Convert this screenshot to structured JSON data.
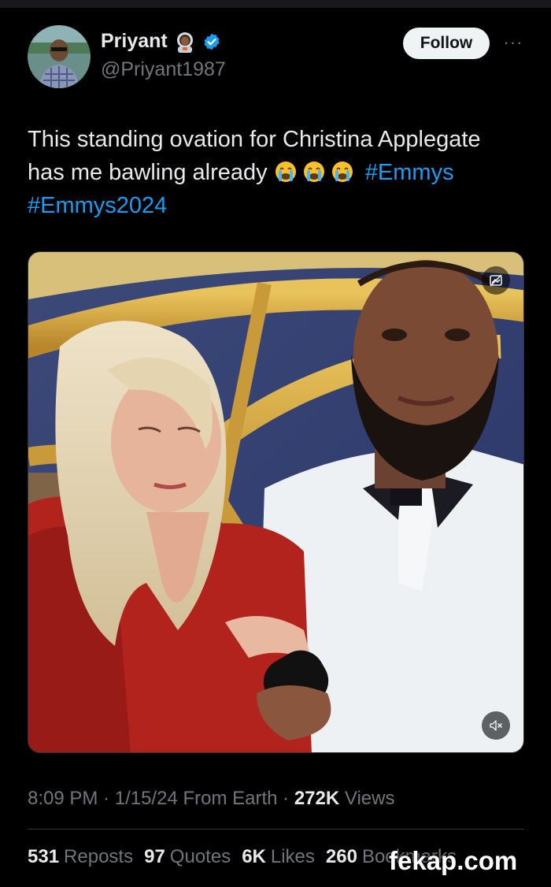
{
  "author": {
    "display_name": "Priyant",
    "name_emoji": "astronaut-emoji",
    "verified": true,
    "handle": "@Priyant1987"
  },
  "actions": {
    "follow_label": "Follow",
    "more_label": "···"
  },
  "tweet": {
    "text_part1": "This standing ovation for Christina Applegate has me bawling already ",
    "emojis": [
      "loudly-crying-face",
      "loudly-crying-face",
      "loudly-crying-face"
    ],
    "hashtag1": "#Emmys",
    "hashtag2": "#Emmys2024"
  },
  "media": {
    "type": "video",
    "top_icon": "sensitive-media-icon",
    "mute_icon": "muted-speaker-icon"
  },
  "meta": {
    "time": "8:09 PM",
    "sep1": " · ",
    "date": "1/15/24",
    "source": " From Earth",
    "sep2": " · ",
    "views_count": "272K",
    "views_label": " Views"
  },
  "stats": {
    "reposts_count": "531",
    "reposts_label": "Reposts",
    "quotes_count": "97",
    "quotes_label": "Quotes",
    "likes_count": "6K",
    "likes_label": "Likes",
    "bookmarks_count": "260",
    "bookmarks_label": "Bookmarks"
  },
  "watermark": "fekap.com",
  "colors": {
    "background": "#000000",
    "accent": "#1d9bf0",
    "secondary_text": "#71767b",
    "primary_text": "#e7e9ea"
  }
}
